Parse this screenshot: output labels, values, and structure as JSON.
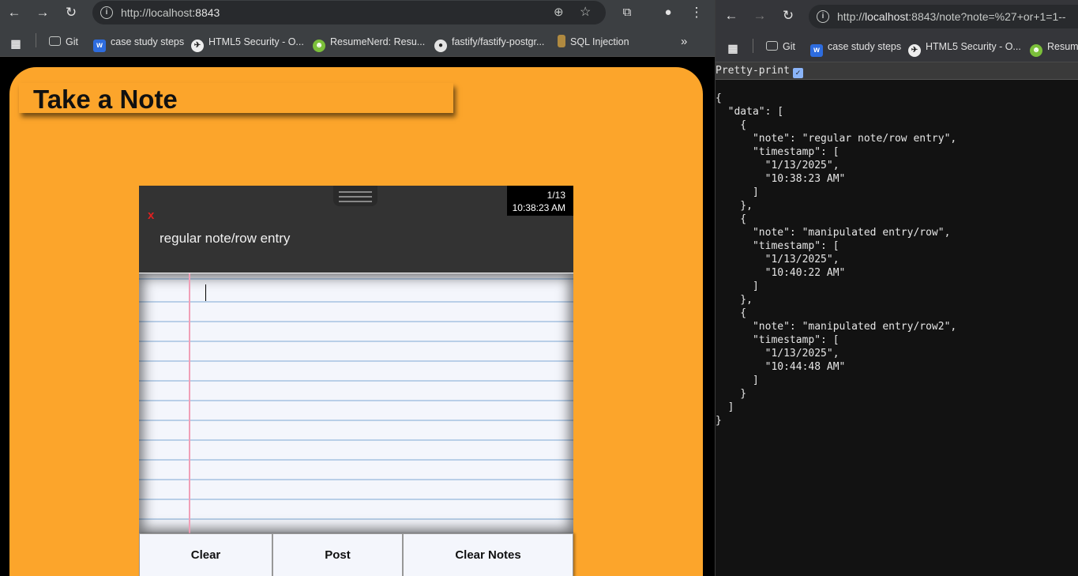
{
  "left_browser": {
    "url_host": "http://localhost",
    "url_port": ":8843",
    "bookmarks": [
      "Git",
      "case study steps",
      "HTML5 Security - O...",
      "ResumeNerd: Resu...",
      "fastify/fastify-postgr...",
      "SQL Injection"
    ],
    "more": "»"
  },
  "right_browser": {
    "url_prefix": "http://",
    "url_host": "localhost",
    "url_rest": ":8843/note?note=%27+or+1=1--",
    "bookmarks": [
      "Git",
      "case study steps",
      "HTML5 Security - O...",
      "Resume"
    ]
  },
  "app": {
    "title": "Take a Note",
    "close": "x",
    "date": "1/13",
    "time": "10:38:23 AM",
    "note": "regular note/row entry",
    "buttons": [
      "Clear",
      "Post",
      "Clear Notes"
    ]
  },
  "pretty_print": {
    "label": "Pretty-print",
    "checked": "✓"
  },
  "json_lines": [
    "{",
    "  \"data\": [",
    "    {",
    "      \"note\": \"regular note/row entry\",",
    "      \"timestamp\": [",
    "        \"1/13/2025\",",
    "        \"10:38:23 AM\"",
    "      ]",
    "    },",
    "    {",
    "      \"note\": \"manipulated entry/row\",",
    "      \"timestamp\": [",
    "        \"1/13/2025\",",
    "        \"10:40:22 AM\"",
    "      ]",
    "    },",
    "    {",
    "      \"note\": \"manipulated entry/row2\",",
    "      \"timestamp\": [",
    "        \"1/13/2025\",",
    "        \"10:44:48 AM\"",
    "      ]",
    "    }",
    "  ]",
    "}"
  ]
}
